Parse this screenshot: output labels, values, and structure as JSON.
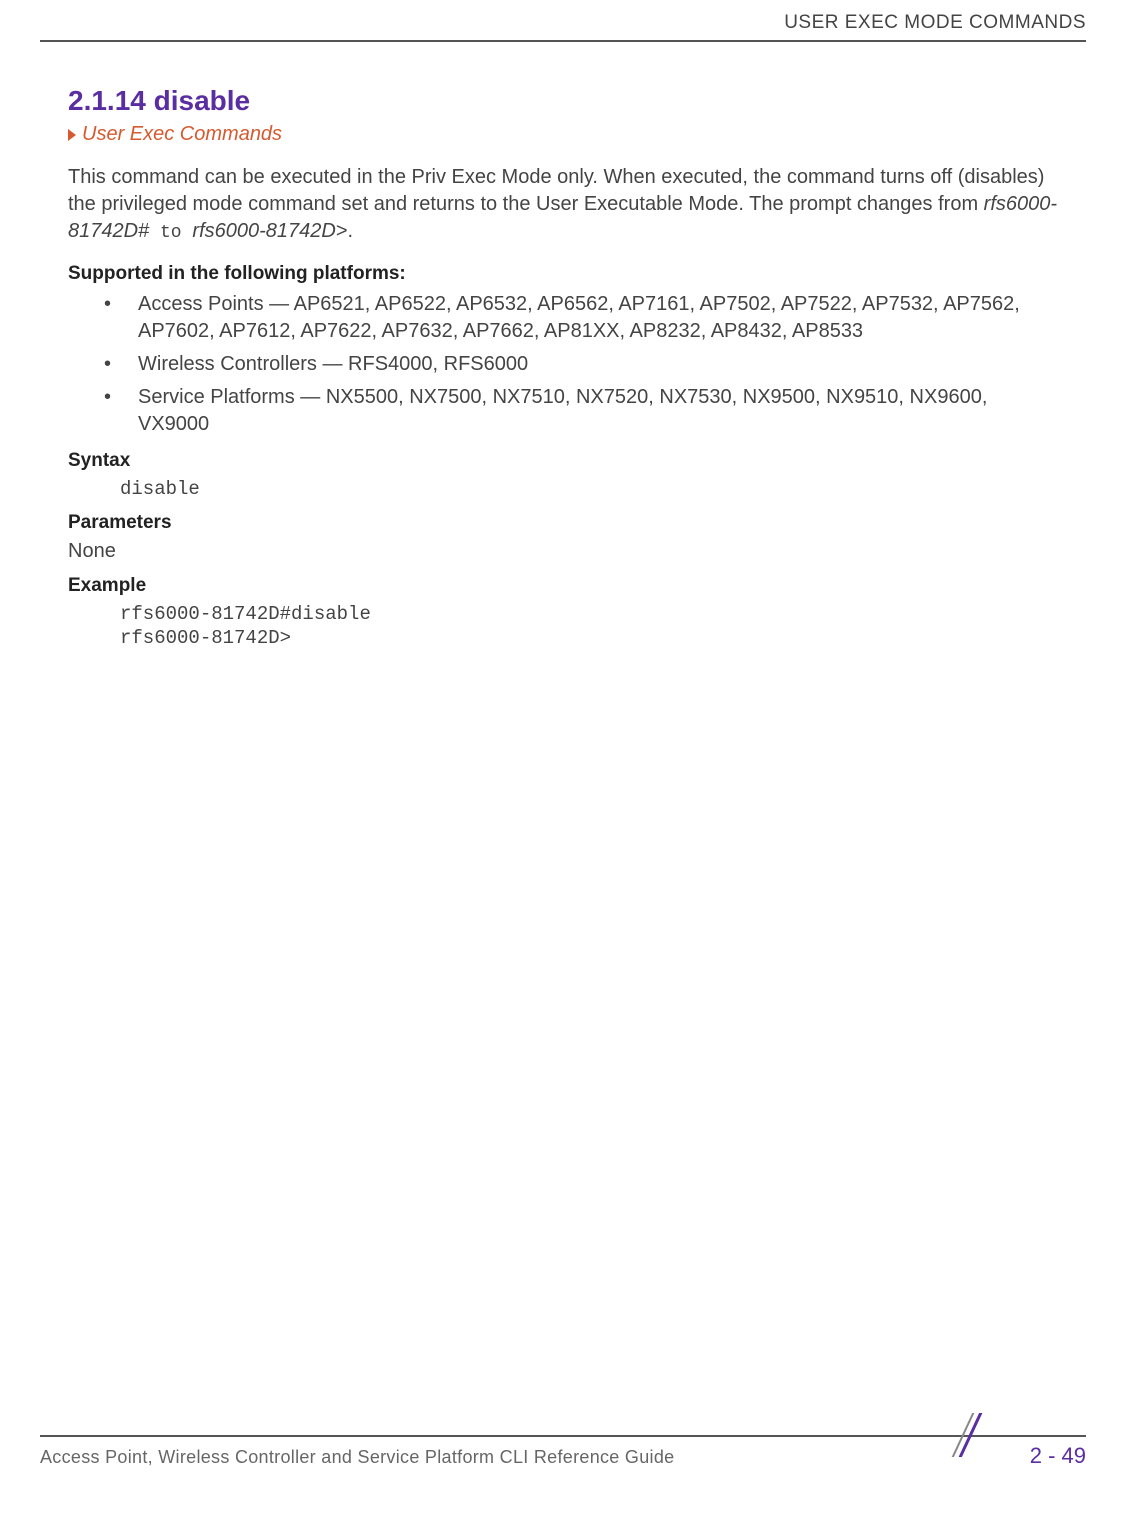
{
  "header": {
    "title": "USER EXEC MODE COMMANDS"
  },
  "section": {
    "number_title": "2.1.14 disable",
    "breadcrumb": "User Exec Commands",
    "intro_part1": "This command can be executed in the Priv Exec Mode only. When executed, the command turns off (disables) the privileged mode command set and returns to the User Executable Mode. The prompt changes from ",
    "intro_italic1": "rfs6000-81742D#",
    "intro_mono": " to ",
    "intro_italic2": "rfs6000-81742D",
    "intro_part2": ">.",
    "supported_heading": "Supported in the following platforms:",
    "platforms": [
      "Access Points — AP6521, AP6522, AP6532, AP6562, AP7161, AP7502, AP7522, AP7532, AP7562, AP7602, AP7612, AP7622, AP7632, AP7662, AP81XX, AP8232, AP8432, AP8533",
      "Wireless Controllers — RFS4000, RFS6000",
      "Service Platforms — NX5500, NX7500, NX7510, NX7520, NX7530, NX9500, NX9510, NX9600, VX9000"
    ],
    "syntax_heading": "Syntax",
    "syntax_code": "disable",
    "parameters_heading": "Parameters",
    "parameters_value": "None",
    "example_heading": "Example",
    "example_code": "rfs6000-81742D#disable\nrfs6000-81742D>"
  },
  "footer": {
    "title": "Access Point, Wireless Controller and Service Platform CLI Reference Guide",
    "page": "2 - 49"
  }
}
